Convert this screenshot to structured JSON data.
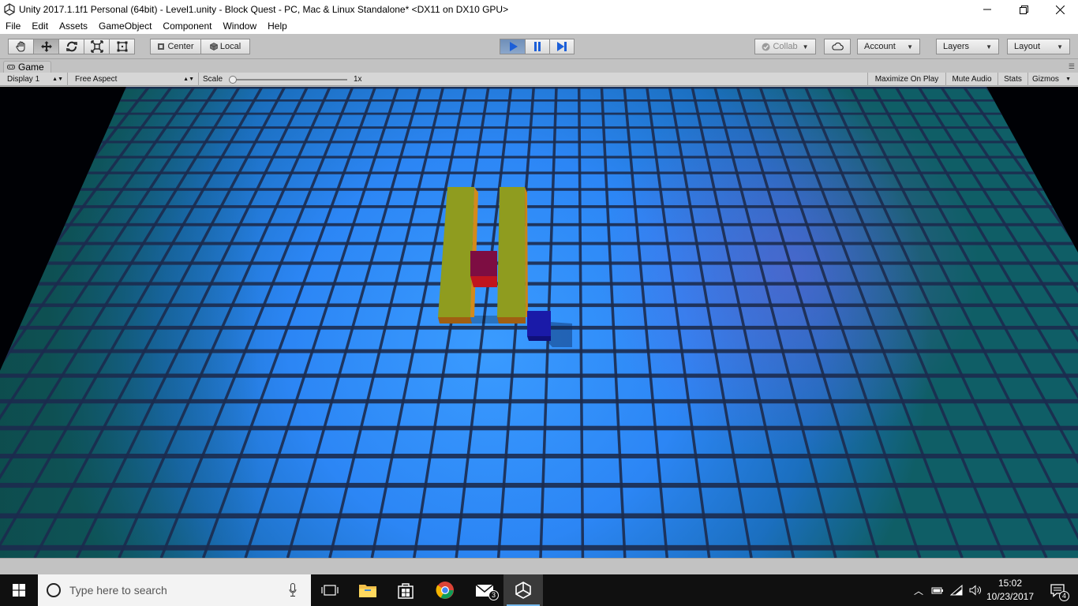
{
  "window": {
    "title": "Unity 2017.1.1f1 Personal (64bit) - Level1.unity - Block Quest - PC, Mac & Linux Standalone* <DX11 on DX10 GPU>"
  },
  "menu": {
    "items": [
      "File",
      "Edit",
      "Assets",
      "GameObject",
      "Component",
      "Window",
      "Help"
    ]
  },
  "toolbar": {
    "pivot_label": "Center",
    "space_label": "Local",
    "collab_label": "Collab",
    "account_label": "Account",
    "layers_label": "Layers",
    "layout_label": "Layout"
  },
  "game": {
    "tab_label": "Game",
    "display_label": "Display 1",
    "aspect_label": "Free Aspect",
    "scale_label": "Scale",
    "scale_value": "1x",
    "maximize_label": "Maximize On Play",
    "mute_label": "Mute Audio",
    "stats_label": "Stats",
    "gizmos_label": "Gizmos"
  },
  "taskbar": {
    "search_placeholder": "Type here to search",
    "mail_badge": "3",
    "time": "15:02",
    "date": "10/23/2017",
    "notification_count": "4"
  },
  "colors": {
    "play_active": "#7b9cc6",
    "floor_light": "#2e8cff",
    "floor_edge": "#0f5a5a",
    "wall": "#8a9a1e",
    "red_block": "#b0103a",
    "blue_block": "#1515a0"
  }
}
